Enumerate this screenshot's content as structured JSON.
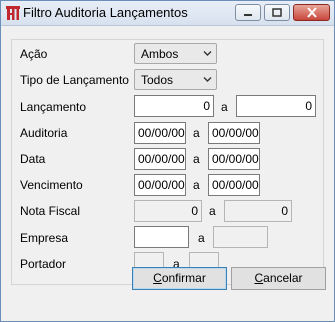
{
  "window": {
    "title": "Filtro Auditoria Lançamentos"
  },
  "fields": {
    "acao": {
      "label": "Ação",
      "value": "Ambos"
    },
    "tipo": {
      "label": "Tipo de Lançamento",
      "value": "Todos"
    },
    "lancamento": {
      "label": "Lançamento",
      "from": "0",
      "to": "0"
    },
    "auditoria": {
      "label": "Auditoria",
      "from": "00/00/00",
      "to": "00/00/00"
    },
    "data": {
      "label": "Data",
      "from": "00/00/00",
      "to": "00/00/00"
    },
    "vencimento": {
      "label": "Vencimento",
      "from": "00/00/00",
      "to": "00/00/00"
    },
    "nota_fiscal": {
      "label": "Nota Fiscal",
      "from": "0",
      "to": "0"
    },
    "empresa": {
      "label": "Empresa",
      "from": "",
      "to": ""
    },
    "portador": {
      "label": "Portador",
      "from": "",
      "to": ""
    }
  },
  "range_sep": "a",
  "buttons": {
    "confirm_mnemonic": "C",
    "confirm_rest": "onfirmar",
    "cancel_mnemonic": "C",
    "cancel_rest": "ancelar"
  }
}
